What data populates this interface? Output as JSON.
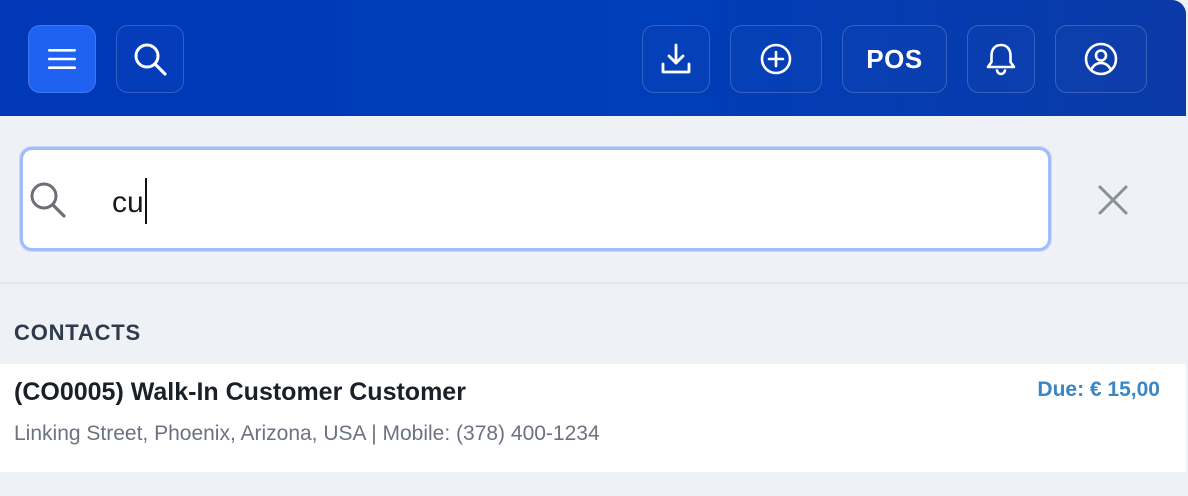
{
  "topbar": {
    "menu_icon": "hamburger-menu-icon",
    "search_icon": "search-icon",
    "download_icon": "download-icon",
    "add_icon": "plus-circle-icon",
    "pos_label": "POS",
    "bell_icon": "bell-icon",
    "user_icon": "user-circle-icon",
    "brand_color": "#003db8",
    "active_button_color": "#1f61f0"
  },
  "search": {
    "value": "cu",
    "search_icon": "search-icon",
    "clear_icon": "close-icon"
  },
  "results": {
    "section_label": "CONTACTS",
    "contacts": [
      {
        "name": "(CO0005) Walk-In Customer Customer",
        "due": "Due: € 15,00",
        "detail": "Linking Street, Phoenix, Arizona, USA | Mobile: (378) 400-1234"
      }
    ]
  },
  "colors": {
    "due_text": "#3b86c4",
    "focus_border": "#9fbdf6"
  }
}
